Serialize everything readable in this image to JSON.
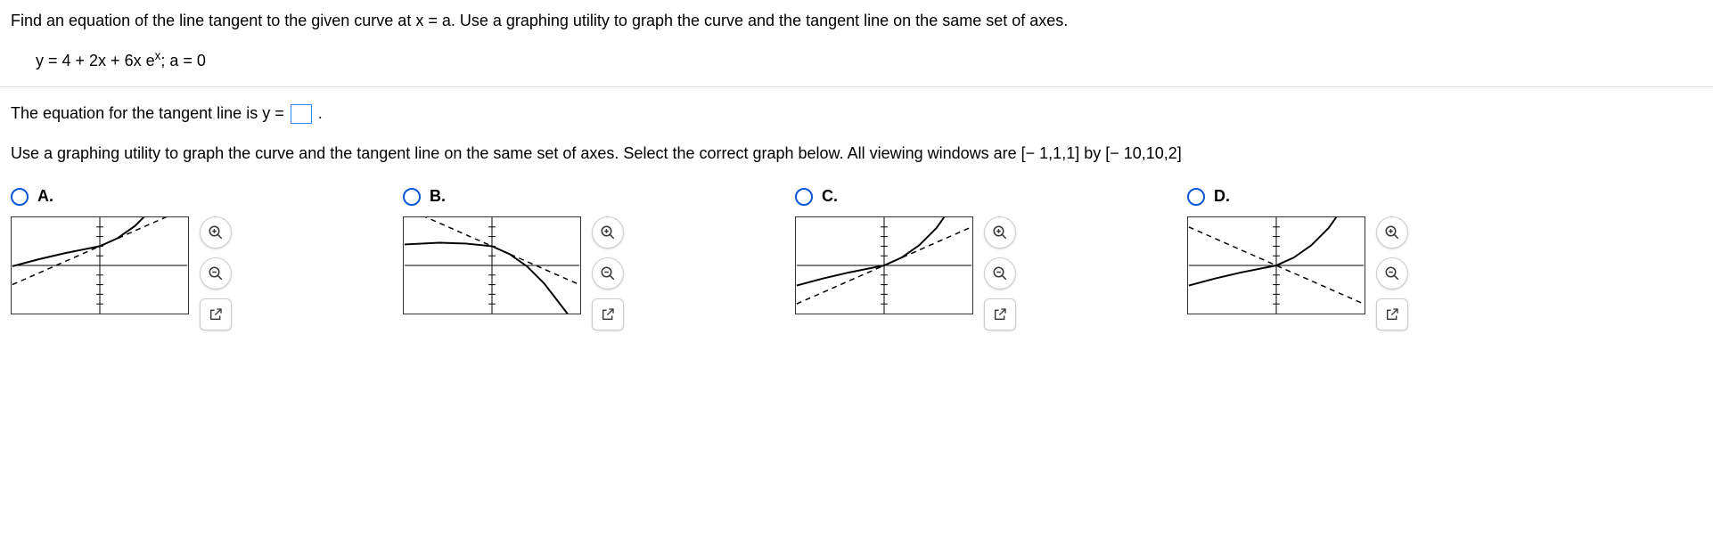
{
  "problem": {
    "prompt": "Find an equation of the line tangent to the given curve at x = a. Use a graphing utility to graph the curve and the tangent line on the same set of axes.",
    "equation_prefix": "y = 4 + 2x + 6x e",
    "equation_sup": "x",
    "equation_suffix": "; a = 0"
  },
  "answer_prompt": {
    "before": "The equation for the tangent line is y = ",
    "after": "."
  },
  "graph_prompt": "Use a graphing utility to graph the curve and the tangent line on the same set of axes. Select the correct graph below. All viewing windows are [− 1,1,1] by [− 10,10,2]",
  "options": [
    {
      "label": "A."
    },
    {
      "label": "B."
    },
    {
      "label": "C."
    },
    {
      "label": "D."
    }
  ],
  "chart_data": [
    {
      "type": "line",
      "title": "Option A",
      "xlabel": "",
      "ylabel": "",
      "xlim": [
        -1,
        1
      ],
      "ylim": [
        -10,
        10
      ],
      "series": [
        {
          "name": "curve",
          "style": "solid",
          "x": [
            -1,
            -0.5,
            0,
            0.5,
            1
          ],
          "y": [
            -0.2,
            2.2,
            4,
            10.9,
            22.3
          ]
        },
        {
          "name": "tangent",
          "style": "dashed",
          "x": [
            -1,
            1
          ],
          "y": [
            -4,
            12
          ]
        }
      ]
    },
    {
      "type": "line",
      "title": "Option B",
      "xlabel": "",
      "ylabel": "",
      "xlim": [
        -1,
        1
      ],
      "ylim": [
        -10,
        10
      ],
      "series": [
        {
          "name": "curve",
          "style": "solid",
          "x": [
            -1,
            -0.5,
            0,
            0.5,
            1
          ],
          "y": [
            4.4,
            4.8,
            4,
            -1.9,
            -13.3
          ]
        },
        {
          "name": "tangent",
          "style": "dashed",
          "x": [
            -1,
            1
          ],
          "y": [
            12,
            -4
          ]
        }
      ]
    },
    {
      "type": "line",
      "title": "Option C",
      "xlabel": "",
      "ylabel": "",
      "xlim": [
        -1,
        1
      ],
      "ylim": [
        -10,
        10
      ],
      "series": [
        {
          "name": "curve",
          "style": "solid",
          "x": [
            -1,
            -0.5,
            0,
            0.5,
            1
          ],
          "y": [
            -4.2,
            -1.8,
            0,
            6.9,
            18.3
          ]
        },
        {
          "name": "tangent",
          "style": "dashed",
          "x": [
            -1,
            1
          ],
          "y": [
            -8,
            8
          ]
        }
      ]
    },
    {
      "type": "line",
      "title": "Option D",
      "xlabel": "",
      "ylabel": "",
      "xlim": [
        -1,
        1
      ],
      "ylim": [
        -10,
        10
      ],
      "series": [
        {
          "name": "curve",
          "style": "solid",
          "x": [
            -1,
            -0.5,
            0,
            0.5,
            1
          ],
          "y": [
            -4.2,
            -1.8,
            0,
            6.9,
            18.3
          ]
        },
        {
          "name": "tangent",
          "style": "dashed",
          "x": [
            -1,
            1
          ],
          "y": [
            8,
            -8
          ]
        }
      ]
    }
  ]
}
